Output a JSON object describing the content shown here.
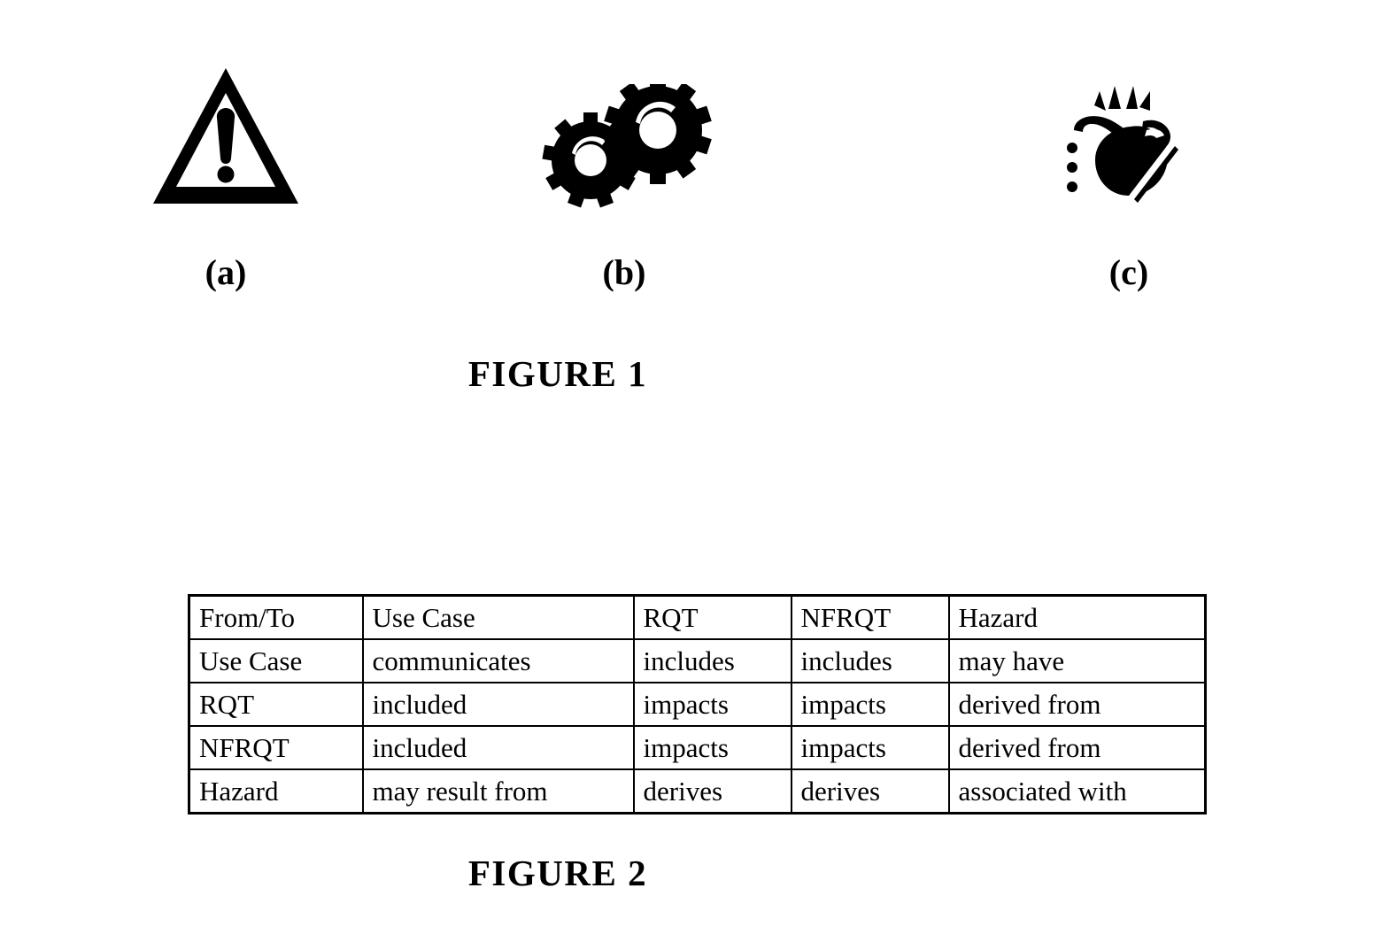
{
  "figure1": {
    "caption": "FIGURE 1",
    "items": [
      {
        "label": "(a)",
        "icon": "warning-triangle-exclamation-icon",
        "alt": "warning triangle with exclamation mark"
      },
      {
        "label": "(b)",
        "icon": "two-gears-icon",
        "alt": "two meshing gears"
      },
      {
        "label": "(c)",
        "icon": "bomb-lit-fuse-icon",
        "alt": "bomb with lit fuse and sparks"
      }
    ]
  },
  "figure2": {
    "caption": "FIGURE 2",
    "table": {
      "header": [
        "From/To",
        "Use Case",
        "RQT",
        "NFRQT",
        "Hazard"
      ],
      "rows": [
        [
          "Use Case",
          "communicates",
          "includes",
          "includes",
          "may have"
        ],
        [
          "RQT",
          "included",
          "impacts",
          "impacts",
          "derived from"
        ],
        [
          "NFRQT",
          "included",
          "impacts",
          "impacts",
          "derived from"
        ],
        [
          "Hazard",
          "may result from",
          "derives",
          "derives",
          "associated with"
        ]
      ]
    }
  },
  "colors": {
    "ink": "#000000",
    "paper": "#ffffff"
  }
}
